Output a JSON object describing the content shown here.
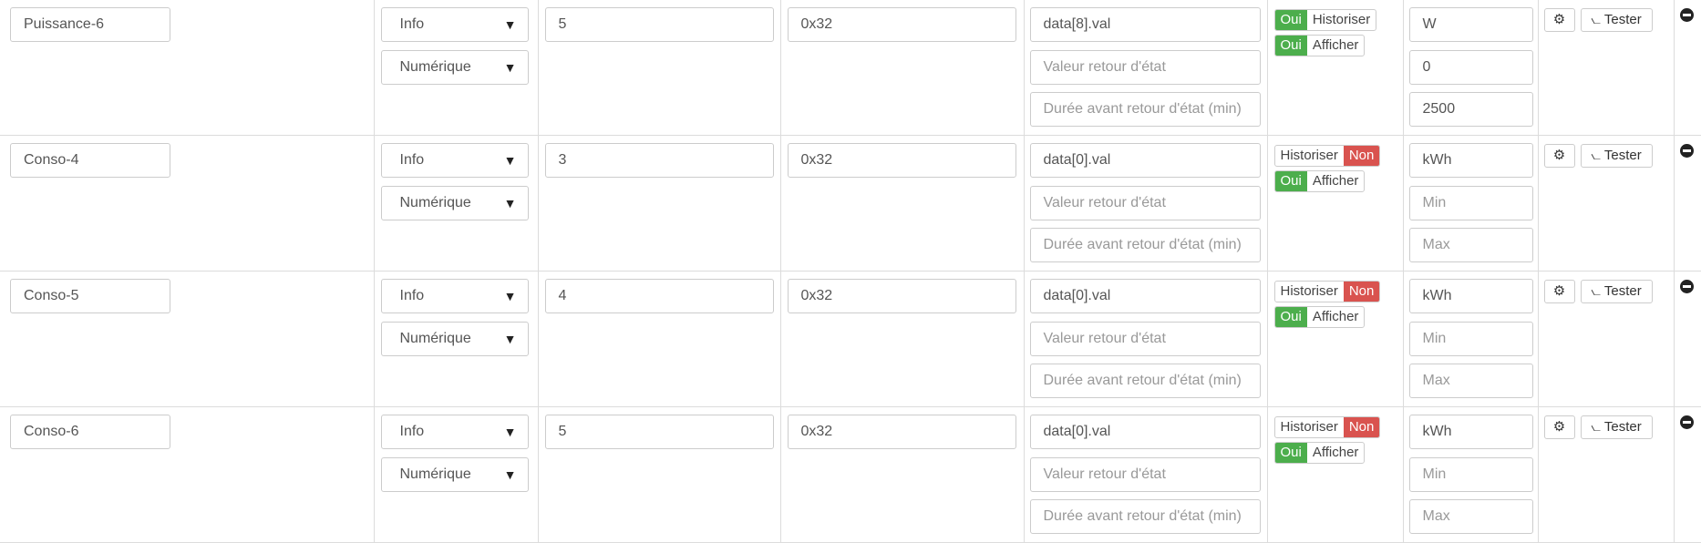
{
  "rows": [
    {
      "name": "Puissance-6",
      "type": "Info",
      "subtype": "Numérique",
      "register": "5",
      "hex": "0x32",
      "data": "data[8].val",
      "retour_placeholder": "Valeur retour d'état",
      "duree_placeholder": "Durée avant retour d'état (min)",
      "historiser": {
        "state_label": "Oui",
        "text": "Historiser",
        "enabled": true
      },
      "afficher": {
        "state_label": "Oui",
        "text": "Afficher",
        "enabled": true
      },
      "unit": "W",
      "min": "0",
      "max": "2500",
      "min_placeholder": "Min",
      "max_placeholder": "Max",
      "test_label": "Tester"
    },
    {
      "name": "Conso-4",
      "type": "Info",
      "subtype": "Numérique",
      "register": "3",
      "hex": "0x32",
      "data": "data[0].val",
      "retour_placeholder": "Valeur retour d'état",
      "duree_placeholder": "Durée avant retour d'état (min)",
      "historiser": {
        "state_label": "Non",
        "text": "Historiser",
        "enabled": false
      },
      "afficher": {
        "state_label": "Oui",
        "text": "Afficher",
        "enabled": true
      },
      "unit": "kWh",
      "min": "",
      "max": "",
      "min_placeholder": "Min",
      "max_placeholder": "Max",
      "test_label": "Tester"
    },
    {
      "name": "Conso-5",
      "type": "Info",
      "subtype": "Numérique",
      "register": "4",
      "hex": "0x32",
      "data": "data[0].val",
      "retour_placeholder": "Valeur retour d'état",
      "duree_placeholder": "Durée avant retour d'état (min)",
      "historiser": {
        "state_label": "Non",
        "text": "Historiser",
        "enabled": false
      },
      "afficher": {
        "state_label": "Oui",
        "text": "Afficher",
        "enabled": true
      },
      "unit": "kWh",
      "min": "",
      "max": "",
      "min_placeholder": "Min",
      "max_placeholder": "Max",
      "test_label": "Tester"
    },
    {
      "name": "Conso-6",
      "type": "Info",
      "subtype": "Numérique",
      "register": "5",
      "hex": "0x32",
      "data": "data[0].val",
      "retour_placeholder": "Valeur retour d'état",
      "duree_placeholder": "Durée avant retour d'état (min)",
      "historiser": {
        "state_label": "Non",
        "text": "Historiser",
        "enabled": false
      },
      "afficher": {
        "state_label": "Oui",
        "text": "Afficher",
        "enabled": true
      },
      "unit": "kWh",
      "min": "",
      "max": "",
      "min_placeholder": "Min",
      "max_placeholder": "Max",
      "test_label": "Tester"
    }
  ],
  "icons": {
    "config": "gears-icon",
    "test": "rss-icon",
    "remove": "minus-circle-icon"
  },
  "colors": {
    "on": "#4cae4c",
    "off": "#d9534f"
  }
}
